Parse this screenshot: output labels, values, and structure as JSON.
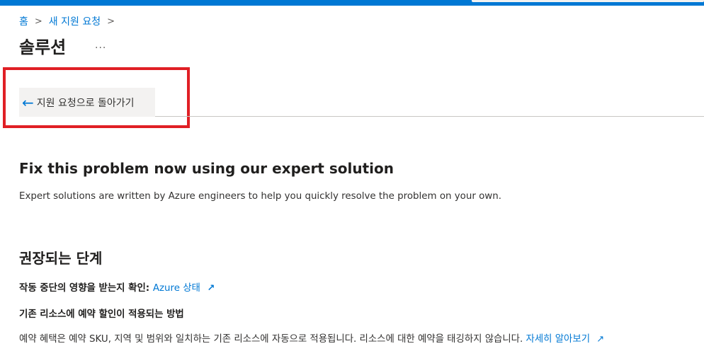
{
  "breadcrumb": {
    "home": "홈",
    "new_request": "새 지원 요청"
  },
  "page": {
    "title": "솔루션",
    "more": "..."
  },
  "back_button": {
    "label": "지원 요청으로 돌아가기"
  },
  "expert_solution": {
    "title": "Fix this problem now using our expert solution",
    "description": "Expert solutions are written by Azure engineers to help you quickly resolve the problem on your own."
  },
  "recommended_steps": {
    "title": "권장되는 단계",
    "step1_text": "작동 중단의 영향을 받는지 확인:",
    "step1_link": "Azure 상태",
    "step2_title": "기존 리소스에 예약 할인이 적용되는 방법",
    "step2_desc": "예약 혜택은 예약 SKU, 지역 및 범위와 일치하는 기존 리소스에 자동으로 적용됩니다. 리소스에 대한 예약을 태깅하지 않습니다.",
    "step2_link": "자세히 알아보기"
  },
  "icons": {
    "back": "arrow-left-icon",
    "external": "external-link-icon",
    "chevron": "chevron-right-icon"
  },
  "colors": {
    "accent": "#0078d4",
    "highlight": "#e01f25"
  }
}
